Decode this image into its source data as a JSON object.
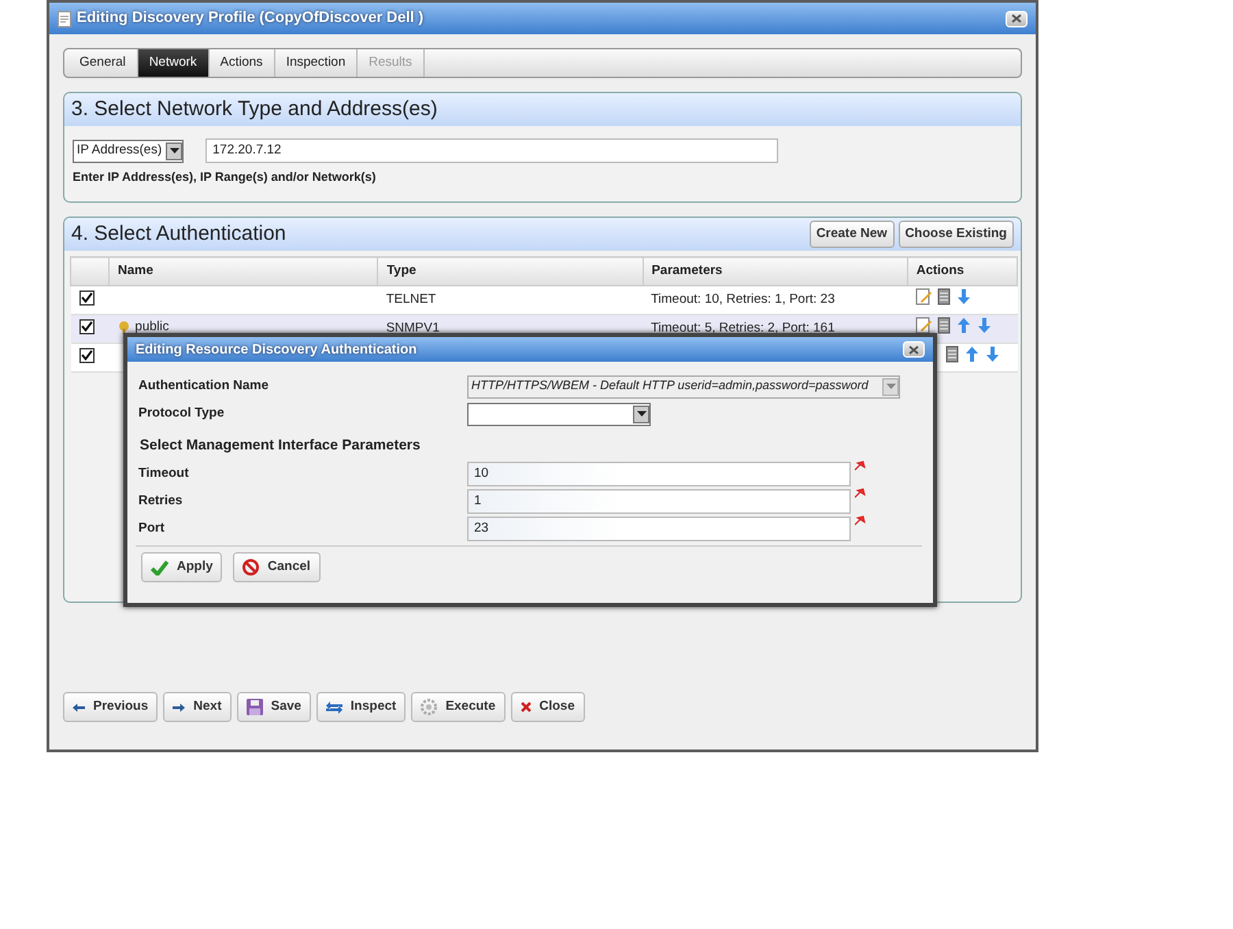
{
  "window": {
    "title": "Editing Discovery Profile (CopyOfDiscover Dell )"
  },
  "tabs": [
    {
      "label": "General",
      "selected": false,
      "disabled": false
    },
    {
      "label": "Network",
      "selected": true,
      "disabled": false
    },
    {
      "label": "Actions",
      "selected": false,
      "disabled": false
    },
    {
      "label": "Inspection",
      "selected": false,
      "disabled": false
    },
    {
      "label": "Results",
      "selected": false,
      "disabled": true
    }
  ],
  "network_section": {
    "title": "3. Select Network Type and Address(es)",
    "type_select": "IP Address(es)",
    "address": "172.20.7.12",
    "hint": "Enter IP Address(es), IP Range(s) and/or Network(s)"
  },
  "auth_section": {
    "title": "4. Select Authentication",
    "buttons": [
      "Create New",
      "Choose Existing"
    ],
    "columns": [
      "Name",
      "Type",
      "Parameters",
      "Actions"
    ],
    "rows": [
      {
        "checked": true,
        "name": "",
        "type": "TELNET",
        "parameters": "Timeout: 10, Retries: 1, Port: 23",
        "actions": [
          {
            "kind": "edit"
          },
          {
            "kind": "grid"
          },
          {
            "kind": "down"
          }
        ]
      },
      {
        "checked": true,
        "name": "public",
        "type": "SNMPV1",
        "parameters": "Timeout: 5, Retries: 2, Port: 161",
        "actions": [
          {
            "kind": "edit"
          },
          {
            "kind": "grid"
          },
          {
            "kind": "up"
          },
          {
            "kind": "down"
          }
        ]
      },
      {
        "checked": true,
        "actions": [
          {
            "kind": "grid"
          },
          {
            "kind": "up"
          },
          {
            "kind": "down"
          }
        ]
      }
    ]
  },
  "modal": {
    "title": "Editing Resource Discovery Authentication",
    "fields": [
      {
        "kind": "select",
        "label": "Authentication Name",
        "value": "HTTP/HTTPS/WBEM - Default HTTP userid=admin,password=password",
        "disabled": true
      },
      {
        "kind": "select",
        "label": "Protocol Type",
        "disabled": false
      },
      {
        "kind": "heading",
        "label": "Select Management Interface Parameters"
      },
      {
        "kind": "input",
        "label": "Timeout",
        "value": "10",
        "required": true
      },
      {
        "kind": "input",
        "label": "Retries",
        "value": "1",
        "required": true
      },
      {
        "kind": "input",
        "label": "Port",
        "value": "23",
        "required": true
      }
    ],
    "buttons": [
      "Apply",
      "Cancel"
    ]
  },
  "footer_buttons": [
    "Previous",
    "Next",
    "Save",
    "Inspect",
    "Execute",
    "Close"
  ]
}
